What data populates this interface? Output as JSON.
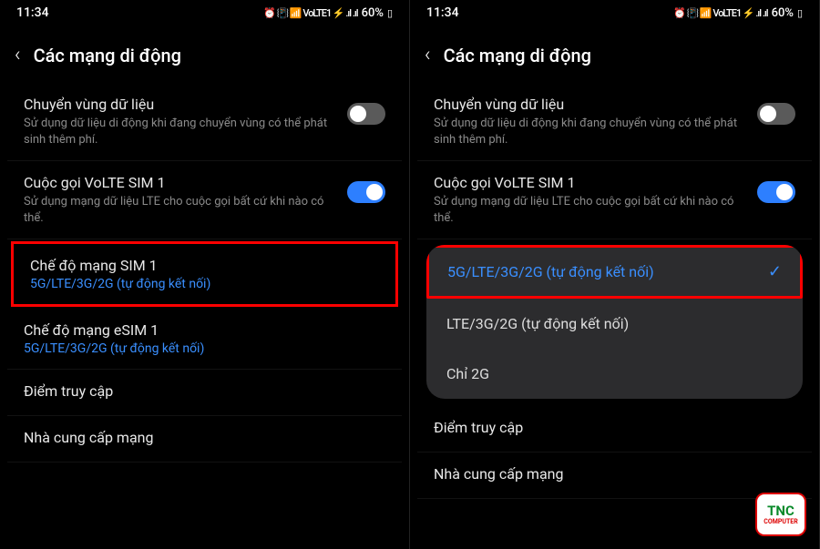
{
  "status": {
    "time": "11:34",
    "icons": "⏰ 📳 📶 VoLTE1 ⚡ .ıl .ıl",
    "battery_pct": "60%",
    "battery_icon": "▯"
  },
  "header": {
    "back": "‹",
    "title": "Các mạng di động"
  },
  "settings": {
    "roaming": {
      "title": "Chuyển vùng dữ liệu",
      "desc": "Sử dụng dữ liệu di động khi đang chuyển vùng có thể phát sinh thêm phí.",
      "enabled": false
    },
    "volte": {
      "title": "Cuộc gọi VoLTE SIM 1",
      "desc": "Sử dụng mạng dữ liệu LTE cho cuộc gọi bất cứ khi nào có thể.",
      "enabled": true
    },
    "mode_sim1": {
      "title": "Chế độ mạng SIM 1",
      "value": "5G/LTE/3G/2G (tự động kết nối)"
    },
    "mode_esim1": {
      "title": "Chế độ mạng eSIM 1",
      "value": "5G/LTE/3G/2G (tự động kết nối)"
    },
    "apn": {
      "title": "Điểm truy cập"
    },
    "carrier": {
      "title": "Nhà cung cấp mạng"
    }
  },
  "dropdown": {
    "options": [
      {
        "label": "5G/LTE/3G/2G (tự động kết nối)",
        "selected": true
      },
      {
        "label": "LTE/3G/2G (tự động kết nối)",
        "selected": false
      },
      {
        "label": "Chỉ 2G",
        "selected": false
      }
    ],
    "check": "✓"
  },
  "watermark": {
    "line1": "TNC",
    "line2": "COMPUTER"
  }
}
